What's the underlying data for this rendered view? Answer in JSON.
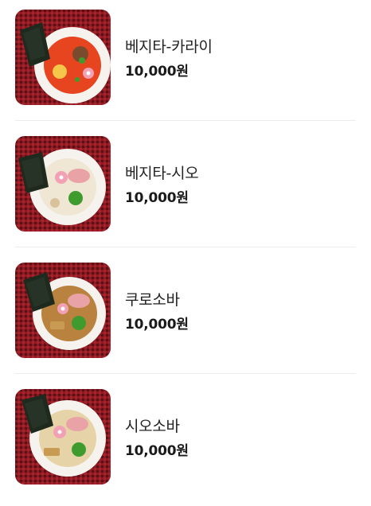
{
  "menu": {
    "items": [
      {
        "name": "베지타-카라이",
        "price": "10,000원",
        "image": "ramen-spicy-red-broth-photo",
        "broth_color": "#e6451f"
      },
      {
        "name": "베지타-시오",
        "price": "10,000원",
        "image": "ramen-shio-white-broth-photo",
        "broth_color": "#efe6d4"
      },
      {
        "name": "쿠로소바",
        "price": "10,000원",
        "image": "ramen-kuro-soy-broth-photo",
        "broth_color": "#b9823f"
      },
      {
        "name": "시오소바",
        "price": "10,000원",
        "image": "ramen-shio-clear-broth-photo",
        "broth_color": "#e6d3a8"
      }
    ]
  },
  "colors": {
    "tablecloth": "#8e1a22",
    "bowl": "#ffffff",
    "nori": "#1f2a1f",
    "scallion": "#3f9b2e",
    "narutomaki": "#f2a0b4"
  }
}
